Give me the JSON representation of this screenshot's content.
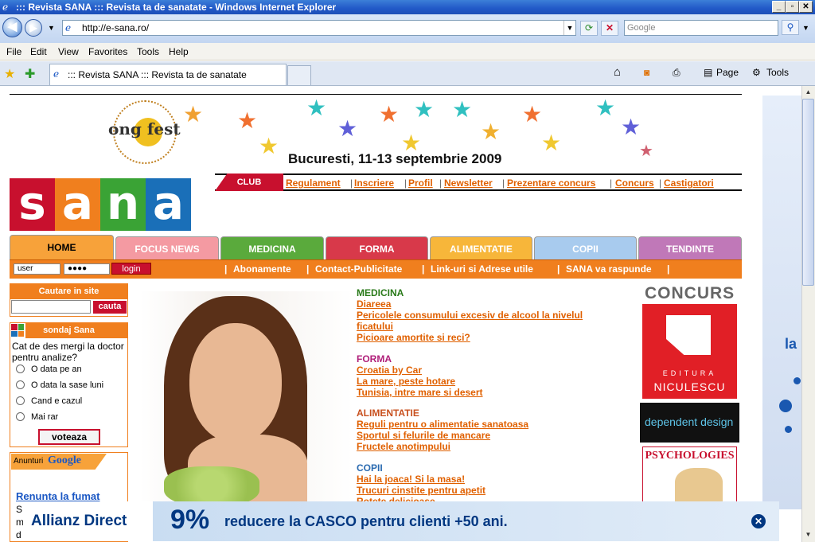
{
  "window": {
    "title": "::: Revista SANA ::: Revista ta de sanatate - Windows Internet Explorer",
    "buttons": [
      "_",
      "▫",
      "✕"
    ]
  },
  "address_bar": {
    "url": "http://e-sana.ro/",
    "search_placeholder": "Google"
  },
  "menu": [
    "File",
    "Edit",
    "View",
    "Favorites",
    "Tools",
    "Help"
  ],
  "tab": {
    "title": "::: Revista SANA ::: Revista ta de sanatate"
  },
  "command_bar": {
    "page": "Page",
    "tools": "Tools"
  },
  "banner": {
    "logo_text": "ong fest",
    "date": "Bucuresti, 11-13 septembrie 2009"
  },
  "site_logo": [
    "s",
    "a",
    "n",
    "a"
  ],
  "site_logo_colors": [
    "#c8102e",
    "#f07f1e",
    "#3aa335",
    "#1a6fb8"
  ],
  "club": {
    "tag": "CLUB",
    "links": [
      "Regulament",
      "Inscriere",
      "Profil",
      "Newsletter",
      "Prezentare concurs",
      "Concurs",
      "Castigatori"
    ]
  },
  "nav_tabs": [
    {
      "label": "HOME",
      "color": "#f7a23a"
    },
    {
      "label": "FOCUS NEWS",
      "color": "#f49aa2"
    },
    {
      "label": "MEDICINA",
      "color": "#5aaa3c"
    },
    {
      "label": "FORMA",
      "color": "#d8394a"
    },
    {
      "label": "ALIMENTATIE",
      "color": "#f7b63a"
    },
    {
      "label": "COPII",
      "color": "#a8cbee"
    },
    {
      "label": "TENDINTE",
      "color": "#c078b8"
    }
  ],
  "login": {
    "user_value": "user",
    "password_value": "●●●●",
    "button": "login"
  },
  "sub_links": [
    "Abonamente",
    "Contact-Publicitate",
    "Link-uri si Adrese utile",
    "SANA va raspunde"
  ],
  "search_box": {
    "title": "Cautare in site",
    "button": "cauta"
  },
  "poll": {
    "title": "sondaj Sana",
    "question": "Cat de des mergi la doctor pentru analize?",
    "options": [
      "O data pe an",
      "O data la sase luni",
      "Cand e cazul",
      "Mai rar"
    ],
    "button": "voteaza"
  },
  "google_ads": {
    "title_prefix": "Anunturi",
    "title_brand": "Google",
    "link": "Renunta la fumat",
    "snippet": "S m d"
  },
  "sections": [
    {
      "title": "MEDICINA",
      "color": "#2a7a1a",
      "articles": [
        "Diareea",
        "Pericolele consumului excesiv de alcool la nivelul ficatului",
        "Picioare amortite si reci?"
      ]
    },
    {
      "title": "FORMA",
      "color": "#b0207a",
      "articles": [
        "Croatia by Car",
        "La mare, peste hotare",
        "Tunisia, intre mare si desert"
      ]
    },
    {
      "title": "ALIMENTATIE",
      "color": "#c8501e",
      "articles": [
        "Reguli pentru o alimentatie sanatoasa",
        "Sportul si felurile de mancare",
        "Fructele anotimpului"
      ]
    },
    {
      "title": "COPII",
      "color": "#2a6ab0",
      "articles": [
        "Hai la joaca! Si la masa!",
        "Trucuri cinstite pentru apetit",
        "Rotete delicioase"
      ]
    }
  ],
  "right_col": {
    "concurs": "CONCURS",
    "niculescu_label": "EDITURA",
    "niculescu_brand": "NICULESCU",
    "dependent_design": "dependent design ?",
    "psychologies": "PSYCHOLOGIES"
  },
  "bottom_ad": {
    "brand": "Allianz Direct",
    "percent": "9%",
    "text": "reducere la CASCO pentru clienti +50 ani."
  },
  "side_panel": {
    "text": "la"
  }
}
